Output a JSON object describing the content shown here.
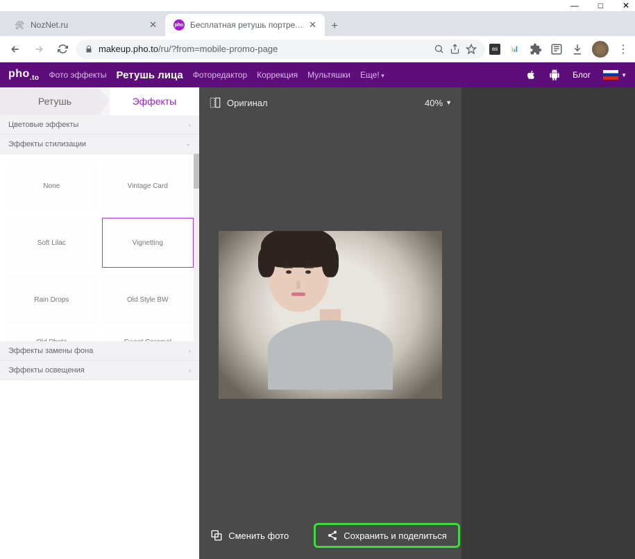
{
  "window": {
    "min": "—",
    "max": "□",
    "close": "✕"
  },
  "tabs": {
    "t1": {
      "title": "NozNet.ru",
      "favicon": "🛠"
    },
    "t2": {
      "title": "Бесплатная ретушь портретных",
      "favicon": "pho"
    }
  },
  "browser": {
    "url_host": "makeup.pho.to",
    "url_path": "/ru/?from=mobile-promo-page"
  },
  "header": {
    "logo": "pho",
    "logo_sub": ".to",
    "menu": {
      "m1": "Фото эффекты",
      "m2": "Ретушь лица",
      "m3": "Фоторедактор",
      "m4": "Коррекция",
      "m5": "Мультяшки",
      "m6": "Еще!"
    },
    "blog": "Блог"
  },
  "sidebar": {
    "tab_retouch": "Ретушь",
    "tab_effects": "Эффекты",
    "acc_color": "Цветовые эффекты",
    "acc_style": "Эффекты стилизации",
    "acc_bg": "Эффекты замены фона",
    "acc_light": "Эффекты освещения",
    "effects": {
      "e0": "None",
      "e1": "Vintage Card",
      "e2": "Soft Lilac",
      "e3": "Vignetting",
      "e4": "Rain Drops",
      "e5": "Old Style BW",
      "e6": "Old Photo",
      "e7": "Sweet Caramel"
    }
  },
  "canvas": {
    "original": "Оригинал",
    "zoom": "40%",
    "change_photo": "Сменить фото",
    "save_share": "Сохранить и поделиться"
  }
}
